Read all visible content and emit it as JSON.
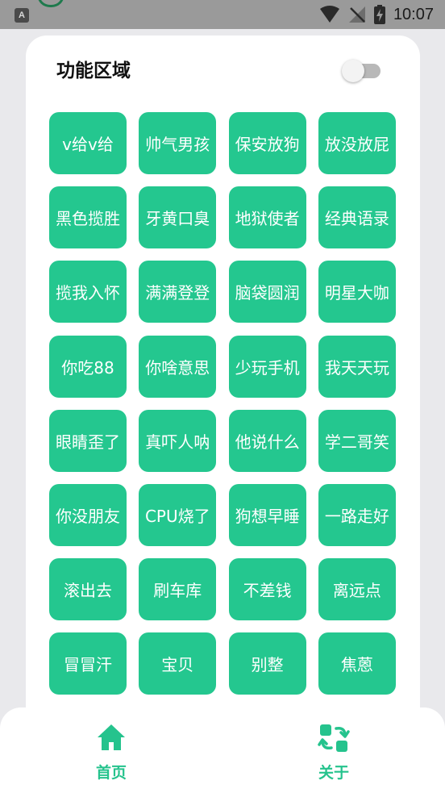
{
  "status_bar": {
    "left_icon_letter": "A",
    "time": "10:07"
  },
  "panel": {
    "title": "功能区域",
    "toggle_on": false
  },
  "function_buttons": [
    "v给v给",
    "帅气男孩",
    "保安放狗",
    "放没放屁",
    "黑色揽胜",
    "牙黄口臭",
    "地狱使者",
    "经典语录",
    "揽我入怀",
    "满满登登",
    "脑袋圆润",
    "明星大咖",
    "你吃88",
    "你啥意思",
    "少玩手机",
    "我天天玩",
    "眼睛歪了",
    "真吓人呐",
    "他说什么",
    "学二哥笑",
    "你没朋友",
    "CPU烧了",
    "狗想早睡",
    "一路走好",
    "滚出去",
    "刷车库",
    "不差钱",
    "离远点",
    "冒冒汗",
    "宝贝",
    "别整",
    "焦蒽"
  ],
  "bottom_nav": {
    "home_label": "首页",
    "about_label": "关于"
  },
  "colors": {
    "accent": "#24c78f",
    "background": "#e9e9ec",
    "status_bar": "#9a9a9a"
  }
}
